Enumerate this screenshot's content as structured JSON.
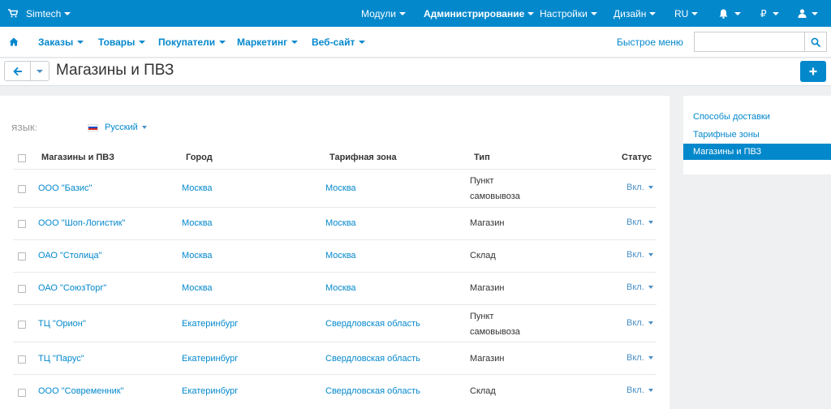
{
  "topbar": {
    "brand": "Simtech",
    "menus": [
      "Модули",
      "Администрирование",
      "Настройки",
      "Дизайн",
      "RU"
    ],
    "currency": "₽"
  },
  "nav": {
    "items": [
      "Заказы",
      "Товары",
      "Покупатели",
      "Маркетинг",
      "Веб-сайт"
    ],
    "quick_menu": "Быстрое меню",
    "search_placeholder": ""
  },
  "page": {
    "title": "Магазины и ПВЗ"
  },
  "language": {
    "label": "ЯЗЫК:",
    "value": "Русский"
  },
  "table": {
    "headers": {
      "name": "Магазины и ПВЗ",
      "city": "Город",
      "zone": "Тарифная зона",
      "type": "Тип",
      "status": "Статус"
    },
    "rows": [
      {
        "name": "ООО \"Базис\"",
        "city": "Москва",
        "zone": "Москва",
        "type": [
          "Пункт",
          "самовывоза"
        ],
        "status": "Вкл."
      },
      {
        "name": "ООО \"Шоп-Логистик\"",
        "city": "Москва",
        "zone": "Москва",
        "type": [
          "Магазин"
        ],
        "status": "Вкл."
      },
      {
        "name": "ОАО \"Столица\"",
        "city": "Москва",
        "zone": "Москва",
        "type": [
          "Склад"
        ],
        "status": "Вкл."
      },
      {
        "name": "ОАО \"СоюзТорг\"",
        "city": "Москва",
        "zone": "Москва",
        "type": [
          "Магазин"
        ],
        "status": "Вкл."
      },
      {
        "name": "ТЦ \"Орион\"",
        "city": "Екатеринбург",
        "zone": "Свердловская область",
        "type": [
          "Пункт",
          "самовывоза"
        ],
        "status": "Вкл."
      },
      {
        "name": "ТЦ \"Парус\"",
        "city": "Екатеринбург",
        "zone": "Свердловская область",
        "type": [
          "Магазин"
        ],
        "status": "Вкл."
      },
      {
        "name": "ООО \"Современник\"",
        "city": "Екатеринбург",
        "zone": "Свердловская область",
        "type": [
          "Склад"
        ],
        "status": "Вкл."
      }
    ]
  },
  "sidebar": {
    "items": [
      {
        "label": "Способы доставки",
        "active": false
      },
      {
        "label": "Тарифные зоны",
        "active": false
      },
      {
        "label": "Магазины и ПВЗ",
        "active": true
      }
    ]
  },
  "colors": {
    "accent": "#0388cc",
    "background": "#eef0f2"
  },
  "icons": [
    "cart-icon",
    "bell-icon",
    "user-icon",
    "home-icon",
    "search-icon",
    "back-arrow-icon",
    "plus-icon",
    "ru-flag-icon"
  ]
}
